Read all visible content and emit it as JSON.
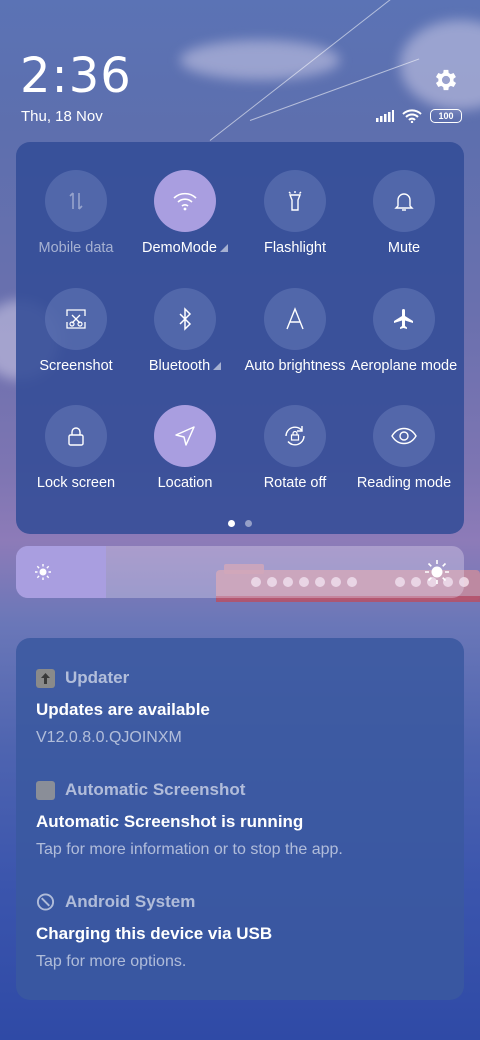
{
  "status": {
    "time": "2:36",
    "date": "Thu, 18 Nov",
    "battery": "100"
  },
  "quick_settings": {
    "tiles": [
      {
        "label": "Mobile data",
        "icon": "mobile-data-icon",
        "active": false,
        "disabled": true
      },
      {
        "label": "DemoMode",
        "icon": "wifi-icon",
        "active": true,
        "expandable": true
      },
      {
        "label": "Flashlight",
        "icon": "flashlight-icon",
        "active": false
      },
      {
        "label": "Mute",
        "icon": "bell-icon",
        "active": false
      },
      {
        "label": "Screenshot",
        "icon": "screenshot-icon",
        "active": false
      },
      {
        "label": "Bluetooth",
        "icon": "bluetooth-icon",
        "active": false,
        "expandable": true
      },
      {
        "label": "Auto brightness",
        "icon": "auto-brightness-icon",
        "active": false
      },
      {
        "label": "Aeroplane mode",
        "icon": "airplane-icon",
        "active": false
      },
      {
        "label": "Lock screen",
        "icon": "lock-icon",
        "active": false
      },
      {
        "label": "Location",
        "icon": "location-icon",
        "active": true
      },
      {
        "label": "Rotate off",
        "icon": "rotate-lock-icon",
        "active": false
      },
      {
        "label": "Reading mode",
        "icon": "eye-icon",
        "active": false
      }
    ],
    "page": 1,
    "pages": 2
  },
  "brightness": {
    "level": 0.2
  },
  "notifications": [
    {
      "app": "Updater",
      "icon": "updater-icon",
      "title": "Updates are available",
      "text": "V12.0.8.0.QJOINXM"
    },
    {
      "app": "Automatic Screenshot",
      "icon": "app-square-icon",
      "title": "Automatic Screenshot is running",
      "text": "Tap for more information or to stop the app."
    },
    {
      "app": "Android System",
      "icon": "android-system-icon",
      "title": "Charging this device via USB",
      "text": "Tap for more options."
    }
  ],
  "colors": {
    "accent": "#a99ee0",
    "panel": "#324c96"
  }
}
